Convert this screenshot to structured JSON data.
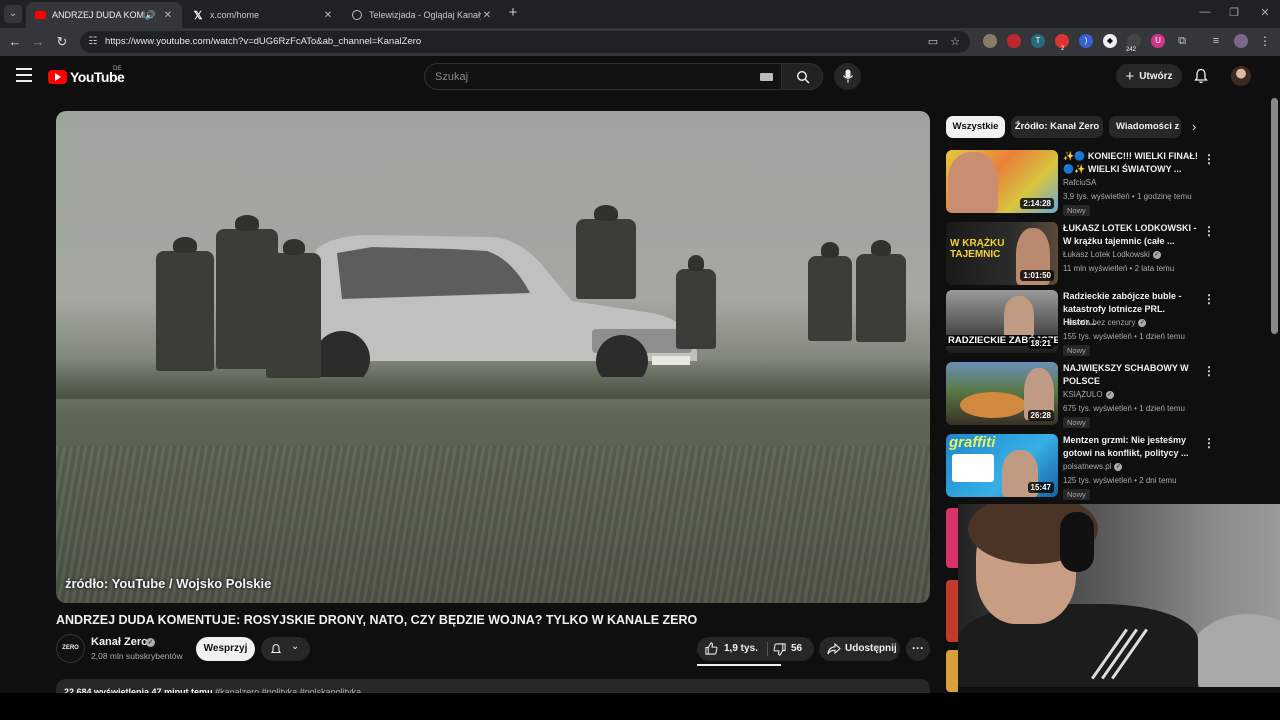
{
  "browser": {
    "tabs": [
      {
        "title": "ANDRZEJ DUDA KOMENTUJE",
        "active": true
      },
      {
        "title": "x.com/home",
        "active": false
      },
      {
        "title": "Telewizjada - Oglądaj Kanały TV",
        "active": false
      }
    ],
    "url": "https://www.youtube.com/watch?v=dUG6RzFcATo&ab_channel=KanalZero",
    "extension_badges": {
      "notifications": "2",
      "count": "242"
    }
  },
  "youtube": {
    "logo_text": "YouTube",
    "country_code": "DE",
    "search_placeholder": "Szukaj",
    "create_label": "Utwórz"
  },
  "video": {
    "overlay_caption": "źródło: YouTube / Wojsko Polskie",
    "title": "ANDRZEJ DUDA KOMENTUJE: ROSYJSKIE DRONY, NATO, CZY BĘDZIE WOJNA? TYLKO W KANALE ZERO",
    "channel": {
      "name": "Kanał Zero",
      "avatar_text": "ZERO",
      "subscribers": "2,08 mln subskrybentów"
    },
    "support_label": "Wesprzyj",
    "likes": "1,9 tys.",
    "dislikes": "56",
    "share_label": "Udostępnij",
    "description": {
      "stats": "22 684 wyświetlenia  47 minut temu",
      "tags": "#kanalzero #polityka #polskapolityka"
    }
  },
  "chips": [
    {
      "label": "Wszystkie",
      "active": true
    },
    {
      "label": "Źródło: Kanał Zero",
      "active": false
    },
    {
      "label": "Wiadomości z",
      "active": false
    }
  ],
  "recommendations": [
    {
      "title": "✨🔵 KONIEC!!! WIELKI FINAŁ! 🔵✨ WIELKI ŚWIATOWY ...",
      "channel": "RafciuSA",
      "verified": false,
      "meta": "3,9 tys. wyświetleń • 1 godzinę temu",
      "badge": "Nowy",
      "duration": "2:14:28",
      "thumb_text": ""
    },
    {
      "title": "ŁUKASZ LOTEK LODKOWSKI - W krążku tajemnic (całe ...",
      "channel": "Łukasz Lotek Lodkowski",
      "verified": true,
      "meta": "11 mln wyświetleń • 2 lata temu",
      "badge": "",
      "duration": "1:01:50",
      "thumb_text": "W KRĄŻKU TAJEMNIC"
    },
    {
      "title": "Radzieckie zabójcze buble - katastrofy lotnicze PRL. Histor...",
      "channel": "Historia bez cenzury",
      "verified": true,
      "meta": "155 tys. wyświetleń • 1 dzień temu",
      "badge": "Nowy",
      "duration": "18:21",
      "thumb_text": "RADZIECKIE ZABÓJCZE"
    },
    {
      "title": "NAJWIĘKSZY SCHABOWY W POLSCE",
      "channel": "KSIĄŻULO",
      "verified": true,
      "meta": "675 tys. wyświetleń • 1 dzień temu",
      "badge": "Nowy",
      "duration": "26:28",
      "thumb_text": ""
    },
    {
      "title": "Mentzen grzmi: Nie jesteśmy gotowi na konflikt, politycy ...",
      "channel": "polsatnews.pl",
      "verified": true,
      "meta": "125 tys. wyświetleń • 2 dni temu",
      "badge": "Nowy",
      "duration": "15:47",
      "thumb_text": "graffiti"
    }
  ],
  "colors": {
    "background": "#0f0f0f",
    "accent": "#ff0000",
    "chip_active": "#f1f1f1"
  }
}
